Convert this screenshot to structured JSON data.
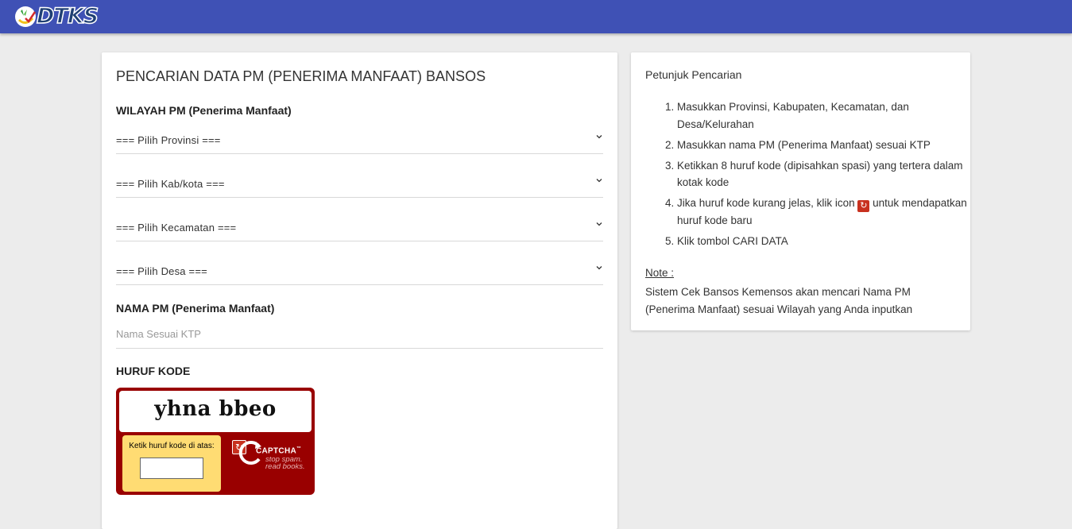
{
  "header": {
    "logo_text": "DTKS"
  },
  "form": {
    "title": "PENCARIAN DATA PM (PENERIMA MANFAAT) BANSOS",
    "wilayah_label": "WILAYAH PM (Penerima Manfaat)",
    "provinsi": "=== Pilih Provinsi ===",
    "kabkota": "=== Pilih Kab/kota ===",
    "kecamatan": "=== Pilih Kecamatan ===",
    "desa": "=== Pilih Desa ===",
    "nama_label": "NAMA PM (Penerima Manfaat)",
    "nama_placeholder": "Nama Sesuai KTP",
    "kode_label": "HURUF KODE"
  },
  "captcha": {
    "word": "yhna bbeo",
    "prompt": "Ketik huruf kode di atas:",
    "brand": "CAPTCHA",
    "trademark": "™",
    "tagline_1": "stop spam.",
    "tagline_2": "read books."
  },
  "help": {
    "title": "Petunjuk Pencarian",
    "steps": [
      "Masukkan Provinsi, Kabupaten, Kecamatan, dan Desa/Kelurahan",
      "Masukkan nama PM (Penerima Manfaat) sesuai KTP",
      "Ketikkan 8 huruf kode (dipisahkan spasi) yang tertera dalam kotak kode",
      "Klik tombol CARI DATA"
    ],
    "step4_before": "Jika huruf kode kurang jelas, klik icon",
    "step4_after": "untuk mendapatkan huruf kode baru",
    "note_label": "Note :",
    "note_text": "Sistem Cek Bansos Kemensos akan mencari Nama PM (Penerima Manfaat) sesuai Wilayah yang Anda inputkan"
  },
  "colors": {
    "header_bg": "#3f51b5",
    "captcha_bg": "#990000",
    "captcha_box": "#ffdc73",
    "reload_icon": "#c8311f"
  }
}
